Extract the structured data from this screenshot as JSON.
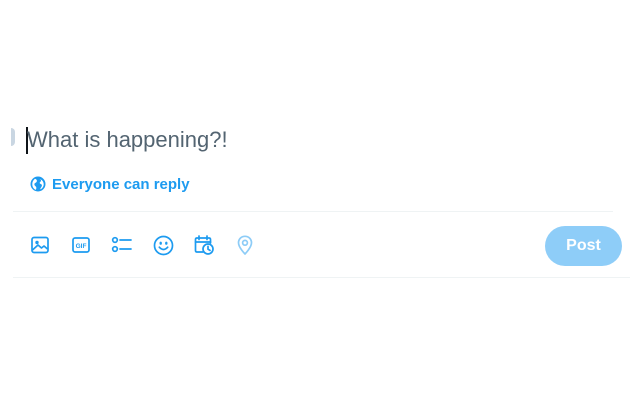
{
  "composer": {
    "placeholder": "What is happening?!",
    "reply_setting": {
      "label": "Everyone can reply",
      "icon": "globe-icon"
    },
    "toolbar": [
      {
        "name": "media",
        "icon": "image-icon"
      },
      {
        "name": "gif",
        "icon": "gif-icon"
      },
      {
        "name": "poll",
        "icon": "poll-icon"
      },
      {
        "name": "emoji",
        "icon": "emoji-icon"
      },
      {
        "name": "schedule",
        "icon": "schedule-icon"
      },
      {
        "name": "location",
        "icon": "location-icon",
        "disabled": true
      }
    ],
    "post_label": "Post"
  },
  "colors": {
    "accent": "#1d9bf0",
    "post_disabled": "#8ecdf8",
    "placeholder": "#536471",
    "divider": "#eff3f4"
  }
}
